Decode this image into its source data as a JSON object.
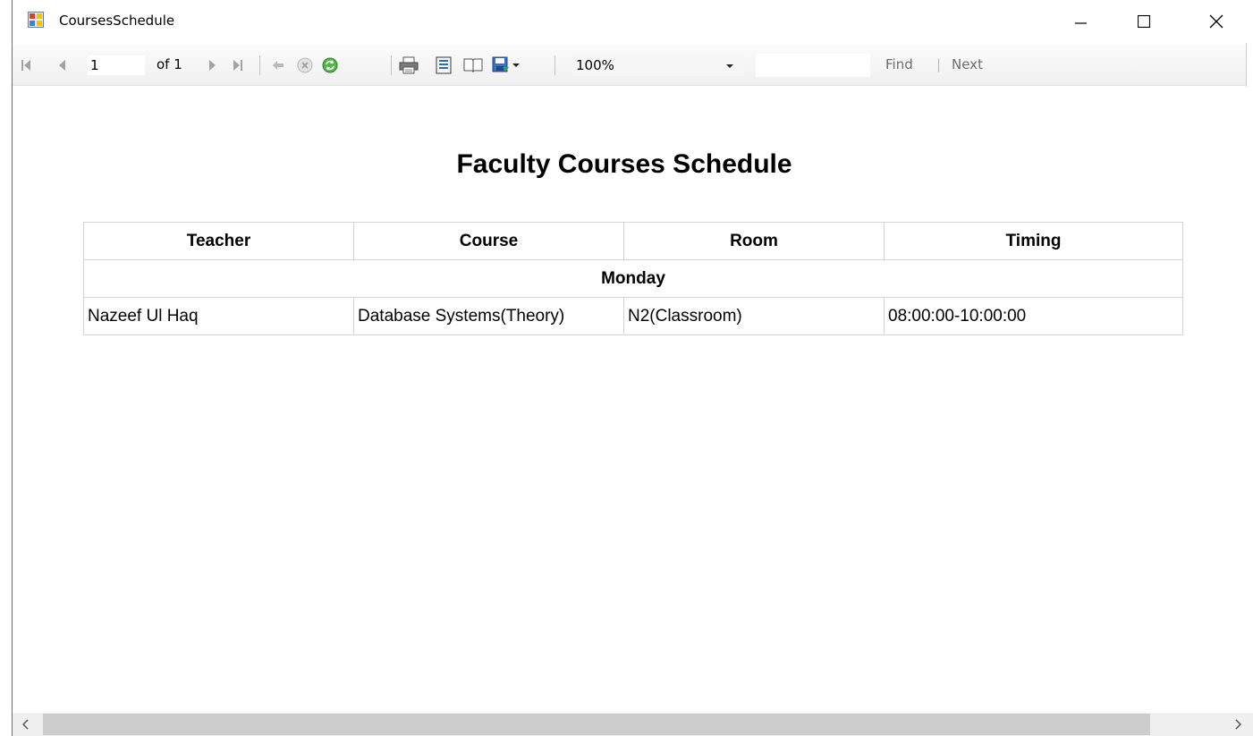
{
  "window": {
    "title": "CoursesSchedule"
  },
  "toolbar": {
    "page_number": "1",
    "page_of": "of 1",
    "zoom_value": "100%",
    "find_label": "Find",
    "find_separator": "|",
    "next_label": "Next",
    "icons": [
      "first-page-icon",
      "previous-page-icon",
      "next-page-icon",
      "last-page-icon",
      "back-icon",
      "stop-icon",
      "refresh-icon",
      "print-icon",
      "print-layout-icon",
      "page-setup-icon",
      "export-icon",
      "export-dropdown-icon",
      "zoom-dropdown-icon"
    ]
  },
  "report": {
    "title": "Faculty Courses Schedule",
    "columns": [
      "Teacher",
      "Course",
      "Room",
      "Timing"
    ],
    "groups": [
      {
        "day": "Monday",
        "rows": [
          [
            "Nazeef Ul Haq",
            "Database Systems(Theory)",
            "N2(Classroom)",
            "08:00:00-10:00:00"
          ]
        ]
      }
    ]
  },
  "colors": {
    "toolbar_bg": "#f0f0f0",
    "table_border": "#d4d4d4",
    "find_text": "#6d6d6d",
    "scrollbar_thumb": "#cdcdcd"
  }
}
